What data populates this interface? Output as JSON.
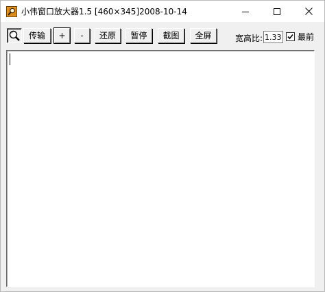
{
  "window": {
    "title": "小伟窗口放大器1.5 [460×345]2008-10-14",
    "icon": "magnifier-app-icon"
  },
  "titlebar_buttons": {
    "minimize_icon": "minimize-icon",
    "maximize_icon": "maximize-icon",
    "close_icon": "close-icon"
  },
  "toolbar": {
    "magnifier_icon": "magnifier-icon",
    "transfer_label": "传输",
    "zoom_in_label": "+",
    "zoom_out_label": "-",
    "restore_label": "还原",
    "pause_label": "暂停",
    "capture_label": "截图",
    "fullscreen_label": "全屏",
    "aspect_ratio_label": "宽高比:",
    "aspect_ratio_value": "1.33",
    "topmost_label": "最前",
    "topmost_checked": true
  },
  "colors": {
    "window_bg": "#f0f0f0",
    "view_bg": "#ffffff",
    "icon_orange": "#d98a1a"
  }
}
